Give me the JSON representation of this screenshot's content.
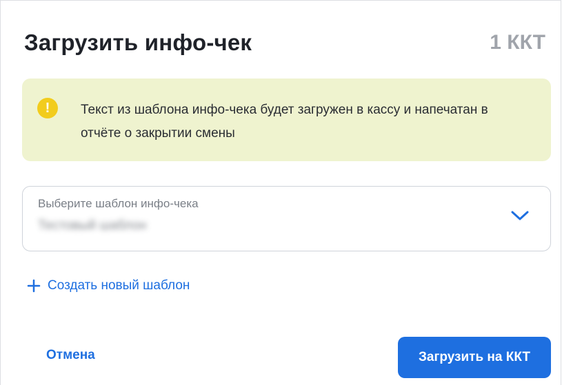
{
  "dialog": {
    "title": "Загрузить инфо-чек",
    "kkt_count": "1 ККТ"
  },
  "notice": {
    "icon": "exclamation-icon",
    "icon_glyph": "!",
    "text": "Текст из шаблона инфо-чека будет загружен в кассу и напечатан в отчёте о закрытии смены",
    "background_color": "#eff3cf",
    "icon_color": "#f2cc1d"
  },
  "template_select": {
    "label": "Выберите шаблон инфо-чека",
    "value": "Тестовый шаблон",
    "icon": "chevron-down-icon"
  },
  "create_template": {
    "icon": "plus-icon",
    "label": "Создать новый шаблон"
  },
  "footer": {
    "cancel_label": "Отмена",
    "submit_label": "Загрузить на ККТ"
  },
  "colors": {
    "accent": "#1e6fe0",
    "muted": "#a0a4ab"
  }
}
